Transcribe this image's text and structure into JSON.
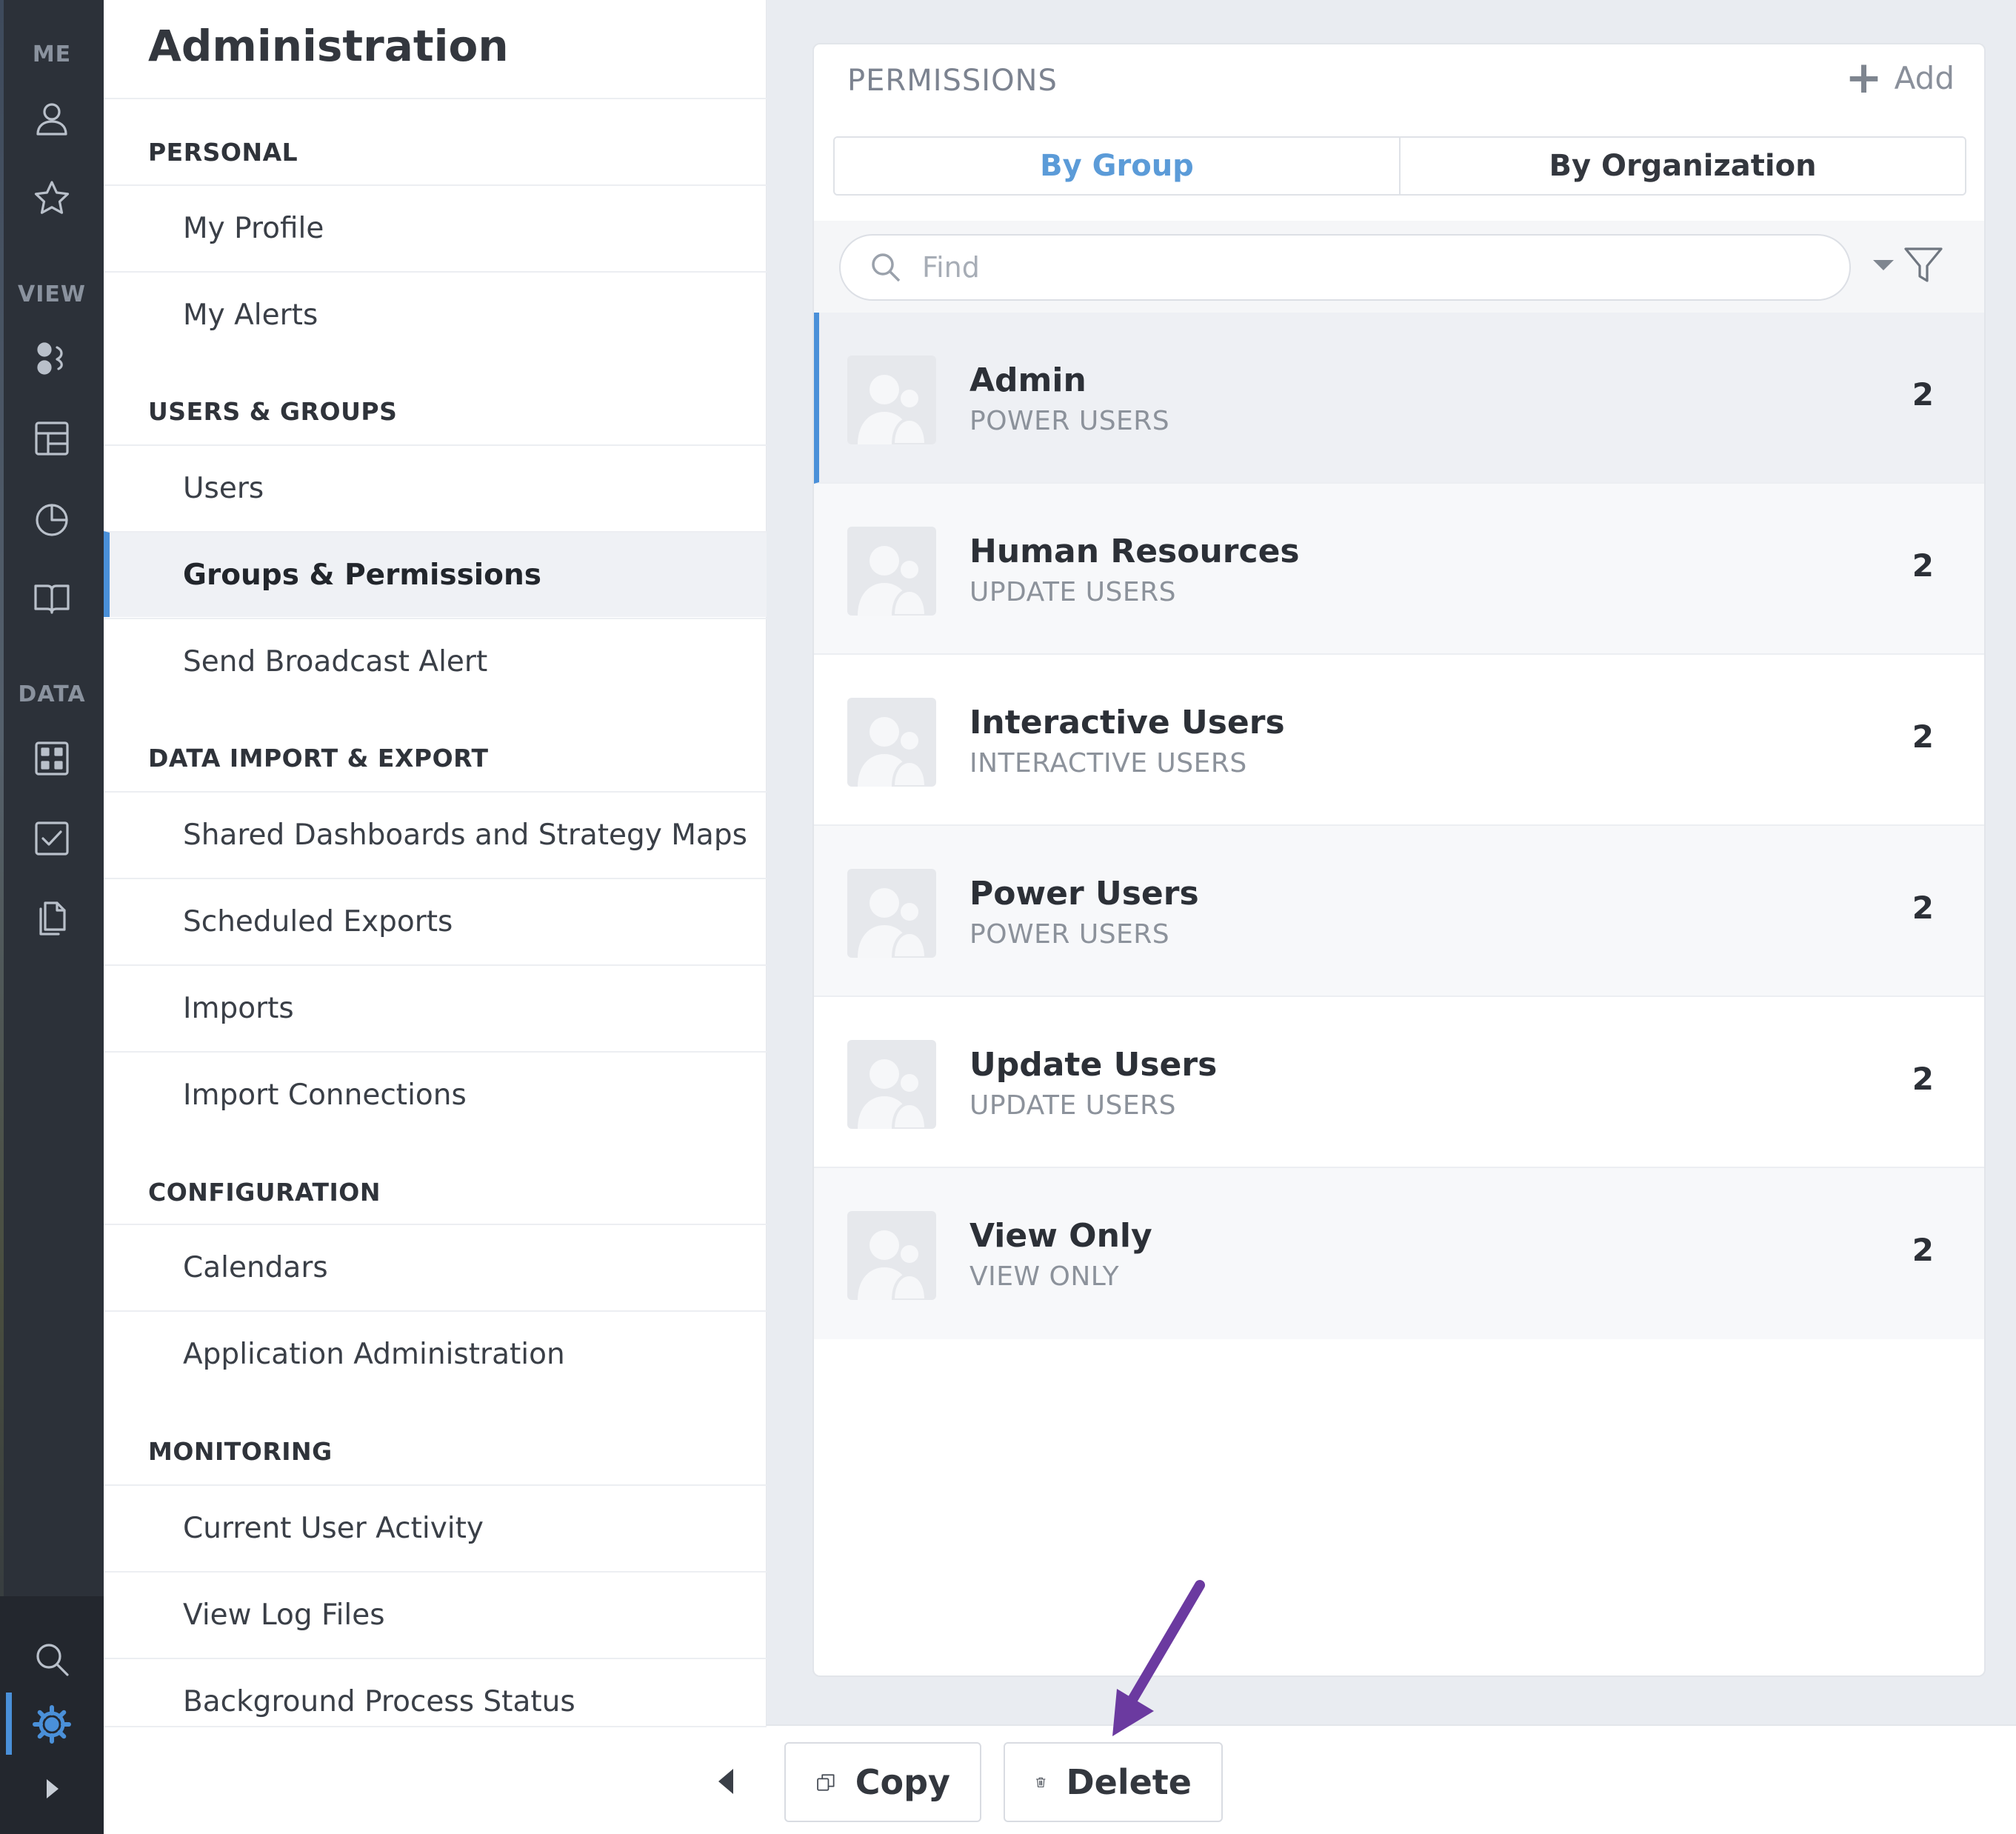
{
  "rail": {
    "sections": [
      "ME",
      "VIEW",
      "DATA"
    ],
    "icons": [
      "user-icon",
      "star-icon",
      "scorecard-icon",
      "dashboard-icon",
      "chart-pie-icon",
      "book-icon",
      "data-grid-icon",
      "checkbox-icon",
      "documents-icon",
      "search-icon",
      "gear-icon",
      "expand-icon"
    ],
    "accent": "#4a90d9"
  },
  "nav": {
    "title": "Administration",
    "sections": [
      {
        "label": "PERSONAL",
        "items": [
          "My Profile",
          "My Alerts"
        ]
      },
      {
        "label": "USERS & GROUPS",
        "items": [
          "Users",
          "Groups & Permissions",
          "Send Broadcast Alert"
        ]
      },
      {
        "label": "DATA IMPORT & EXPORT",
        "items": [
          "Shared Dashboards and Strategy Maps",
          "Scheduled Exports",
          "Imports",
          "Import Connections"
        ]
      },
      {
        "label": "CONFIGURATION",
        "items": [
          "Calendars",
          "Application Administration"
        ]
      },
      {
        "label": "MONITORING",
        "items": [
          "Current User Activity",
          "View Log Files",
          "Background Process Status"
        ]
      }
    ],
    "active_item": "Groups & Permissions"
  },
  "permissions": {
    "title": "PERMISSIONS",
    "add_label": "Add",
    "tabs": [
      "By Group",
      "By Organization"
    ],
    "active_tab": "By Group",
    "search_placeholder": "Find",
    "groups": [
      {
        "name": "Admin",
        "type": "POWER USERS",
        "count": "2"
      },
      {
        "name": "Human Resources",
        "type": "UPDATE USERS",
        "count": "2"
      },
      {
        "name": "Interactive Users",
        "type": "INTERACTIVE USERS",
        "count": "2"
      },
      {
        "name": "Power Users",
        "type": "POWER USERS",
        "count": "2"
      },
      {
        "name": "Update Users",
        "type": "UPDATE USERS",
        "count": "2"
      },
      {
        "name": "View Only",
        "type": "VIEW ONLY",
        "count": "2"
      }
    ],
    "selected_group": "Admin"
  },
  "toolbar": {
    "copy_label": "Copy",
    "delete_label": "Delete"
  },
  "annotation": {
    "color": "#6b3aa0"
  }
}
